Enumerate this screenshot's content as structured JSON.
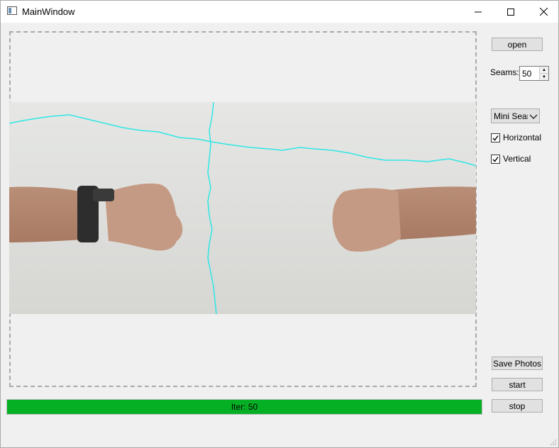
{
  "window": {
    "title": "MainWindow"
  },
  "controls": {
    "open_label": "open",
    "seams_label": "Seams:",
    "seams_value": "50",
    "mode_selected": "Mini Seam",
    "horizontal_label": "Horizontal",
    "horizontal_checked": true,
    "vertical_label": "Vertical",
    "vertical_checked": true,
    "save_label": "Save Photos",
    "start_label": "start",
    "stop_label": "stop"
  },
  "progress": {
    "text": "Iter: 50",
    "fraction": 1.0,
    "color": "#06b025"
  },
  "image": {
    "content": "two fists facing each other over a white wall, wristwatch on left wrist",
    "seam_color": "#2ee6e6"
  }
}
